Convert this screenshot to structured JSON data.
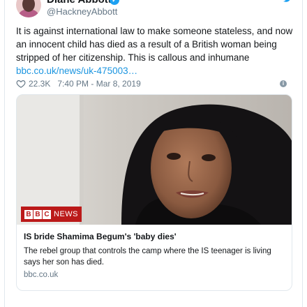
{
  "author": {
    "display_name": "Diane Abbott",
    "handle": "@HackneyAbbott",
    "verified": true
  },
  "tweet": {
    "text": "It is against international law to make someone stateless, and now an innocent child has died as a result of a British woman being stripped of her citizenship. This is callous and inhumane",
    "link": "bbc.co.uk/news/uk-475003…",
    "likes": "22.3K",
    "timestamp": "7:40 PM - Mar 8, 2019"
  },
  "card": {
    "badge_letters": [
      "B",
      "B",
      "C"
    ],
    "badge_word": "NEWS",
    "title": "IS bride Shamima Begum's 'baby dies'",
    "description": "The rebel group that controls the camp where the IS teenager is living says her son has died.",
    "domain": "bbc.co.uk"
  },
  "icons": {
    "verified": "verified-badge-icon",
    "twitter": "twitter-bird-icon",
    "like": "heart-icon",
    "info": "info-icon"
  },
  "colors": {
    "link": "#1b95e0",
    "verified": "#1da1f2",
    "muted": "#657786",
    "bbc_red": "#bb1919"
  }
}
